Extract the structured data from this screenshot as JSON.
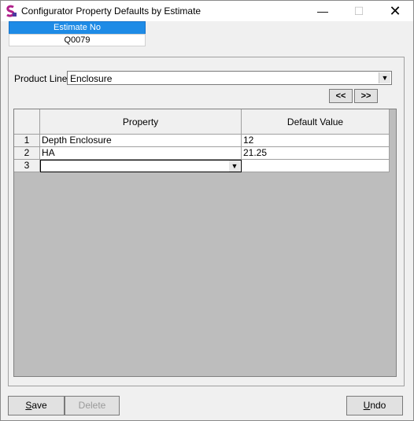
{
  "window": {
    "title": "Configurator Property Defaults by Estimate",
    "minimize_glyph": "—",
    "maximize_glyph": "☐",
    "close_glyph": "✕"
  },
  "estimate": {
    "header": "Estimate No",
    "value": "Q0079"
  },
  "product_line": {
    "label": "Product Line:",
    "value": "Enclosure"
  },
  "nav": {
    "prev": "<<",
    "next": ">>"
  },
  "grid": {
    "columns": [
      "Property",
      "Default Value"
    ],
    "rows": [
      {
        "num": "1",
        "property": "Depth Enclosure",
        "value": "12"
      },
      {
        "num": "2",
        "property": "HA",
        "value": "21.25"
      },
      {
        "num": "3",
        "property": "",
        "value": ""
      }
    ]
  },
  "buttons": {
    "save_mnemonic": "S",
    "save_rest": "ave",
    "delete": "Delete",
    "undo_mnemonic": "U",
    "undo_rest": "ndo"
  },
  "colors": {
    "header_blue": "#1e8be6",
    "grid_background": "#bdbdbd"
  },
  "icons": {
    "app": "app-logo-icon",
    "dropdown": "chevron-down-icon"
  }
}
